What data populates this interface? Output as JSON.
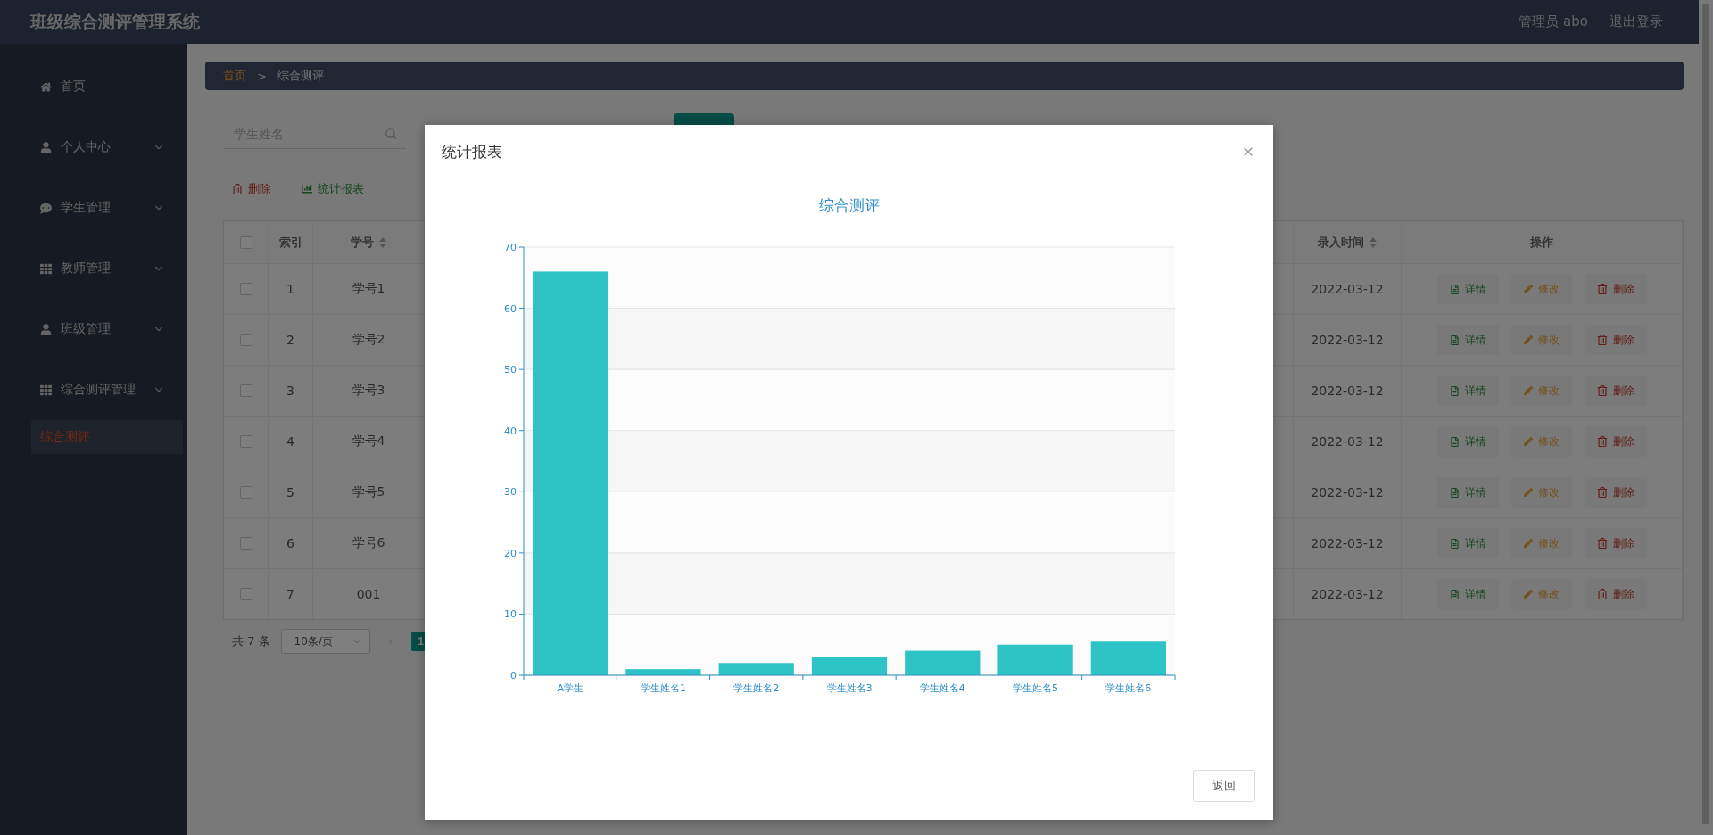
{
  "header": {
    "title": "班级综合测评管理系统",
    "user": "管理员 abo",
    "logout": "退出登录"
  },
  "sidebar": {
    "items": [
      {
        "label": "首页",
        "kind": "link"
      },
      {
        "label": "个人中心",
        "kind": "submenu"
      },
      {
        "label": "学生管理",
        "kind": "submenu"
      },
      {
        "label": "教师管理",
        "kind": "submenu"
      },
      {
        "label": "班级管理",
        "kind": "submenu"
      },
      {
        "label": "综合测评管理",
        "kind": "submenu",
        "children": [
          {
            "label": "综合测评",
            "selected": true
          }
        ]
      }
    ]
  },
  "breadcrumb": {
    "home": "首页",
    "separator": ">",
    "current": "综合测评"
  },
  "search": {
    "placeholder": "学生姓名"
  },
  "actions": [
    {
      "label": "删除",
      "kind": "delete"
    },
    {
      "label": "统计报表",
      "kind": "report"
    }
  ],
  "table": {
    "select_all_checked": false,
    "columns": [
      {
        "label": "索引",
        "sortable": false
      },
      {
        "label": "学号",
        "sortable": true
      },
      {
        "label": "录入时间",
        "sortable": true
      },
      {
        "label": "操作",
        "sortable": false
      }
    ],
    "rows": [
      {
        "index": "1",
        "student_no": "学号1",
        "date": "2022-03-12",
        "checked": false,
        "actions": [
          {
            "label": "详情",
            "kind": "detail"
          },
          {
            "label": "修改",
            "kind": "edit"
          },
          {
            "label": "删除",
            "kind": "delete"
          }
        ]
      },
      {
        "index": "2",
        "student_no": "学号2",
        "date": "2022-03-12",
        "checked": false,
        "actions": [
          {
            "label": "详情",
            "kind": "detail"
          },
          {
            "label": "修改",
            "kind": "edit"
          },
          {
            "label": "删除",
            "kind": "delete"
          }
        ]
      },
      {
        "index": "3",
        "student_no": "学号3",
        "date": "2022-03-12",
        "checked": false,
        "actions": [
          {
            "label": "详情",
            "kind": "detail"
          },
          {
            "label": "修改",
            "kind": "edit"
          },
          {
            "label": "删除",
            "kind": "delete"
          }
        ]
      },
      {
        "index": "4",
        "student_no": "学号4",
        "date": "2022-03-12",
        "checked": false,
        "actions": [
          {
            "label": "详情",
            "kind": "detail"
          },
          {
            "label": "修改",
            "kind": "edit"
          },
          {
            "label": "删除",
            "kind": "delete"
          }
        ]
      },
      {
        "index": "5",
        "student_no": "学号5",
        "date": "2022-03-12",
        "checked": false,
        "actions": [
          {
            "label": "详情",
            "kind": "detail"
          },
          {
            "label": "修改",
            "kind": "edit"
          },
          {
            "label": "删除",
            "kind": "delete"
          }
        ]
      },
      {
        "index": "6",
        "student_no": "学号6",
        "date": "2022-03-12",
        "checked": false,
        "actions": [
          {
            "label": "详情",
            "kind": "detail"
          },
          {
            "label": "修改",
            "kind": "edit"
          },
          {
            "label": "删除",
            "kind": "delete"
          }
        ]
      },
      {
        "index": "7",
        "student_no": "001",
        "date": "2022-03-12",
        "checked": false,
        "actions": [
          {
            "label": "详情",
            "kind": "detail"
          },
          {
            "label": "修改",
            "kind": "edit"
          },
          {
            "label": "删除",
            "kind": "delete"
          }
        ]
      }
    ]
  },
  "pagination": {
    "total": "共 7 条",
    "page_size": "10条/页",
    "pages": [
      {
        "label": "1",
        "selected": true
      }
    ]
  },
  "dialog": {
    "title": "统计报表",
    "button": "返回",
    "chart_data": {
      "type": "bar",
      "title": "综合测评",
      "grid": true,
      "categories": [
        "A学生",
        "学生姓名1",
        "学生姓名2",
        "学生姓名3",
        "学生姓名4",
        "学生姓名5",
        "学生姓名6"
      ],
      "series": [
        {
          "color": "#2ec4c6",
          "values": [
            66,
            1,
            2,
            3,
            4,
            5,
            5.5
          ]
        }
      ],
      "ylim": [
        0,
        70
      ],
      "yticks": [
        0,
        10,
        20,
        30,
        40,
        50,
        60,
        70
      ]
    }
  }
}
